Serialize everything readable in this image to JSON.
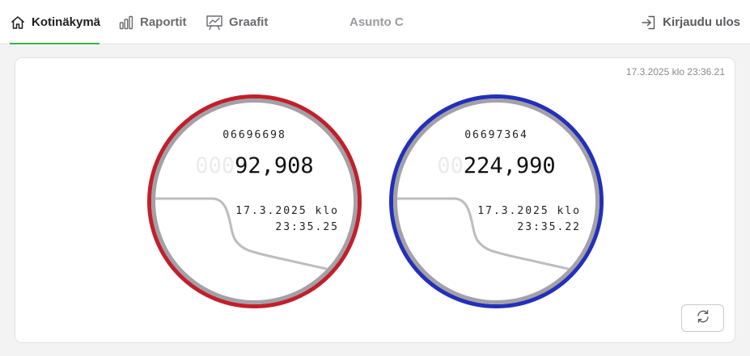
{
  "nav": {
    "home_label": "Kotinäkymä",
    "reports_label": "Raportit",
    "graphs_label": "Graafit",
    "apartment": "Asunto C",
    "logout_label": "Kirjaudu ulos",
    "active_tab": "home",
    "accent_color": "#38b04a"
  },
  "card": {
    "timestamp": "17.3.2025 klo 23:36.21"
  },
  "meters": [
    {
      "id": "06696698",
      "reading_ghost": "000",
      "reading": "92,908",
      "date": "17.3.2025 klo",
      "time": "23:35.25",
      "ring_color": "#c0202b"
    },
    {
      "id": "06697364",
      "reading_ghost": "00",
      "reading": "224,990",
      "date": "17.3.2025 klo",
      "time": "23:35.22",
      "ring_color": "#2430b8"
    }
  ],
  "icons": {
    "home": "home-icon",
    "reports": "bar-chart-icon",
    "graphs": "presentation-chart-icon",
    "logout": "logout-icon",
    "refresh": "refresh-icon"
  }
}
